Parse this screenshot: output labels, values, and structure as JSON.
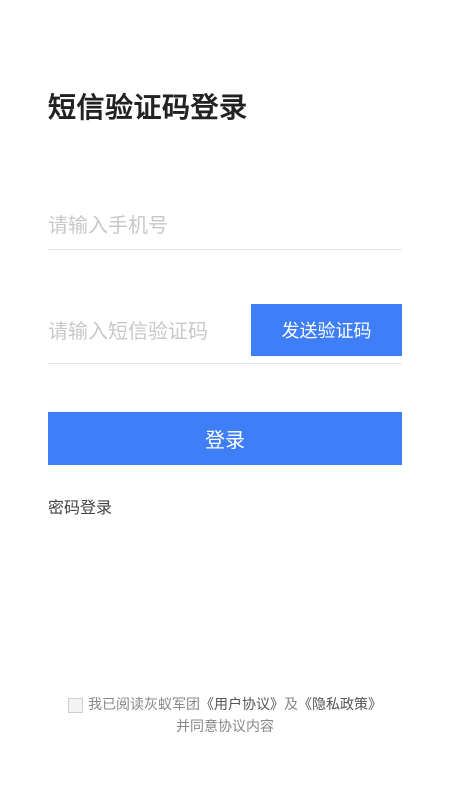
{
  "page": {
    "title": "短信验证码登录"
  },
  "form": {
    "phone_placeholder": "请输入手机号",
    "code_placeholder": "请输入短信验证码",
    "send_code_label": "发送验证码",
    "login_label": "登录"
  },
  "links": {
    "password_login": "密码登录"
  },
  "agreement": {
    "prefix": "我已阅读灰蚁军团",
    "user_agreement": "《用户协议》",
    "conjunction": "及",
    "privacy_policy": "《隐私政策》",
    "suffix": "并同意协议内容"
  },
  "colors": {
    "accent": "#3e7ef7",
    "title": "#222222",
    "placeholder": "#c8c8c8",
    "divider": "#e6e6e6"
  }
}
